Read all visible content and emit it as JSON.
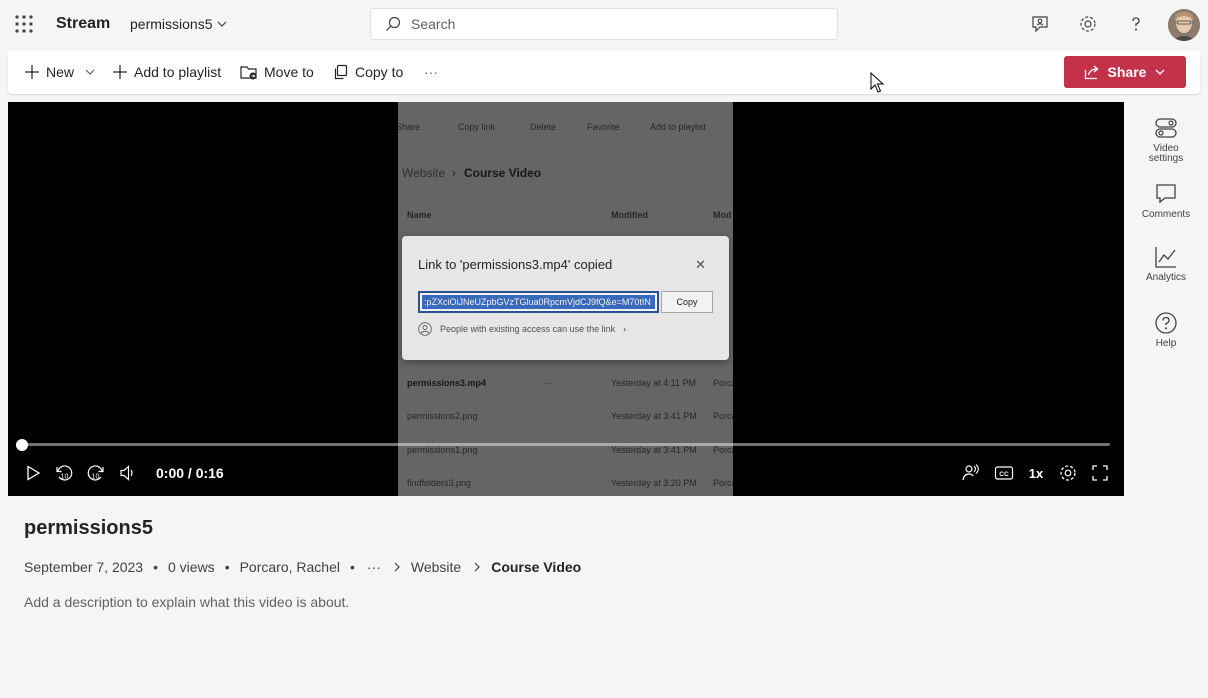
{
  "header": {
    "app_name": "Stream",
    "breadcrumb": "permissions5",
    "search_placeholder": "Search"
  },
  "commands": {
    "new_label": "New",
    "add_to_playlist_label": "Add to playlist",
    "move_to_label": "Move to",
    "copy_to_label": "Copy to",
    "more_label": "···",
    "share_label": "Share"
  },
  "video_frame": {
    "toolbar": [
      "Share",
      "Copy link",
      "Delete",
      "Favorite",
      "Add to playlist"
    ],
    "breadcrumb_parent": "Website",
    "breadcrumb_current": "Course Video",
    "col_name": "Name",
    "col_modified": "Modified",
    "col_mod": "Mod",
    "dialog_title": "Link to 'permissions3.mp4' copied",
    "link_value": ":pZXciOiJNeUZpbGVzTGlua0RpcmVjdCJ9fQ&e=M70tIN",
    "copy_label": "Copy",
    "access_text": "People with existing access can use the link",
    "files": [
      {
        "name": "permissions3.mp4",
        "modified": "Yesterday at 4:11 PM",
        "author": "Porca"
      },
      {
        "name": "permissions2.png",
        "modified": "Yesterday at 3:41 PM",
        "author": "Porca"
      },
      {
        "name": "permissions1.png",
        "modified": "Yesterday at 3:41 PM",
        "author": "Porca"
      },
      {
        "name": "findfolders3.png",
        "modified": "Yesterday at 3:20 PM",
        "author": "Porca"
      }
    ]
  },
  "player": {
    "time": "0:00 / 0:16",
    "progress": 0,
    "speed": "1x",
    "skip_seconds": "10"
  },
  "rail": {
    "video_settings": "Video settings",
    "comments": "Comments",
    "analytics": "Analytics",
    "help": "Help"
  },
  "details": {
    "title": "permissions5",
    "date": "September 7, 2023",
    "views": "0 views",
    "owner": "Porcaro, Rachel",
    "path_more": "···",
    "path_parent": "Website",
    "path_current": "Course Video",
    "description_placeholder": "Add a description to explain what this video is about."
  },
  "colors": {
    "share": "#c4314b",
    "background": "#f5f5f5",
    "player": "#000000"
  }
}
